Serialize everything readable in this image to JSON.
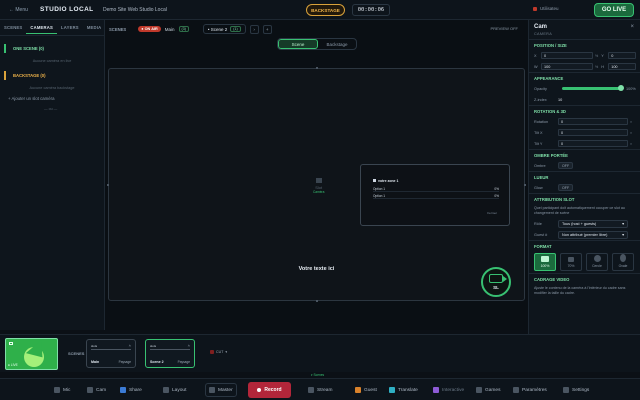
{
  "topbar": {
    "menu": "← Menu",
    "app_title": "STUDIO LOCAL",
    "site_title": "Demo Site Web Studio Local",
    "mode_pill": "BACKSTAGE",
    "timer": "00:00:06",
    "status": "Utilisateu",
    "go_live": "GO LIVE"
  },
  "left_panel": {
    "tabs": [
      "SCENES",
      "CAMERAS",
      "LAYERS",
      "MEDIA"
    ],
    "active_tab": "CAMERAS",
    "section_live": "ONE SCENE (0)",
    "live_empty": "Aucune caméra en live",
    "section_backstage": "BACKSTAGE (0)",
    "backstage_empty": "Aucune caméra backstage",
    "add_camera": "+ Ajouter un slot caméra",
    "sub_note": "— ou —"
  },
  "scenebar": {
    "label": "SCENES",
    "on_air": "● ON AIR",
    "main": "Main",
    "main_count": "(3)",
    "scene2": "• Scene 2",
    "scene2_count": "(1)",
    "next": "›",
    "add": "+",
    "preview": "PREVIEW OFF"
  },
  "view_toggle": {
    "scene": "Scene",
    "backstage": "Backstage",
    "active": "Scene"
  },
  "stage": {
    "center_text": "Votre texte ici",
    "center_icon_label": "Slot",
    "center_icon_sub": "Caméra",
    "popup_title": "votre zone 1",
    "popup_rows": [
      {
        "label": "Option 1",
        "value": "0%"
      },
      {
        "label": "Option 1",
        "value": "0%"
      }
    ],
    "popup_foot": "Fermer",
    "logo_text": "SL"
  },
  "right_panel": {
    "title": "Cam",
    "subtitle": "CAMERA",
    "position_title": "POSITION / SIZE",
    "x_label": "X",
    "x_value": "0",
    "x_unit": "%",
    "y_label": "Y",
    "y_value": "0",
    "w_label": "W",
    "w_value": "100",
    "w_unit": "%",
    "h_label": "H",
    "h_value": "100",
    "appearance_title": "APPEARANCE",
    "opacity_label": "Opacity",
    "opacity_value": "100%",
    "opacity_level": 1.0,
    "zindex_label": "Z-index",
    "zindex_value": "10",
    "rotation_title": "ROTATION & 3D",
    "rotation_label": "Rotation",
    "rotation_value": "0",
    "tiltx_label": "Tilt X",
    "tiltx_value": "0",
    "tilty_label": "Tilt Y",
    "tilty_value": "0",
    "shadow_title": "OMBRE PORTÉE",
    "shadow_label": "Ombre",
    "shadow_value": "OFF",
    "lueur_title": "LUEUR",
    "lueur_label": "Glow",
    "lueur_value": "OFF",
    "slot_title": "ATTRIBUTION SLOT",
    "slot_text": "Quel participant doit automatiquement occuper ce slot au changement de scène",
    "role_label": "Rôle",
    "role_value": "Tous (host + guests)",
    "guest_label": "Guest #",
    "guest_value": "Non attribué (premier libre)",
    "format_title": "FORMAT",
    "formats": [
      "100%",
      "70%",
      "Cercle",
      "Ovale"
    ],
    "format_active": "100%",
    "crop_title": "CADRAGE VIDEO",
    "crop_text": "Ajuste le contenu de la caméra à l'intérieur du cadre sans modifier la taille du cadre."
  },
  "filmstrip": {
    "live_label": "● LIVE",
    "scenes_label": "SCENES",
    "scenes": [
      {
        "tiny": "slots",
        "name": "Main",
        "tag": "Paysage"
      },
      {
        "tiny": "slots",
        "name": "Scene 2",
        "tag": "Paysage"
      }
    ],
    "cut_label": "CUT",
    "more": "▾ Scenes"
  },
  "dock": {
    "mic": "Mic",
    "cam": "Cam",
    "share": "Share",
    "layout": "Layout",
    "master": "Master",
    "record": "Record",
    "stream": "Stream",
    "guest": "Guest",
    "translate": "Translate",
    "interactive": "Interactive",
    "games": "Games",
    "parametres": "Paramètres",
    "settings": "Settings"
  },
  "colors": {
    "accent": "#38c172",
    "warning": "#f2b54a",
    "record": "#b3263a"
  }
}
